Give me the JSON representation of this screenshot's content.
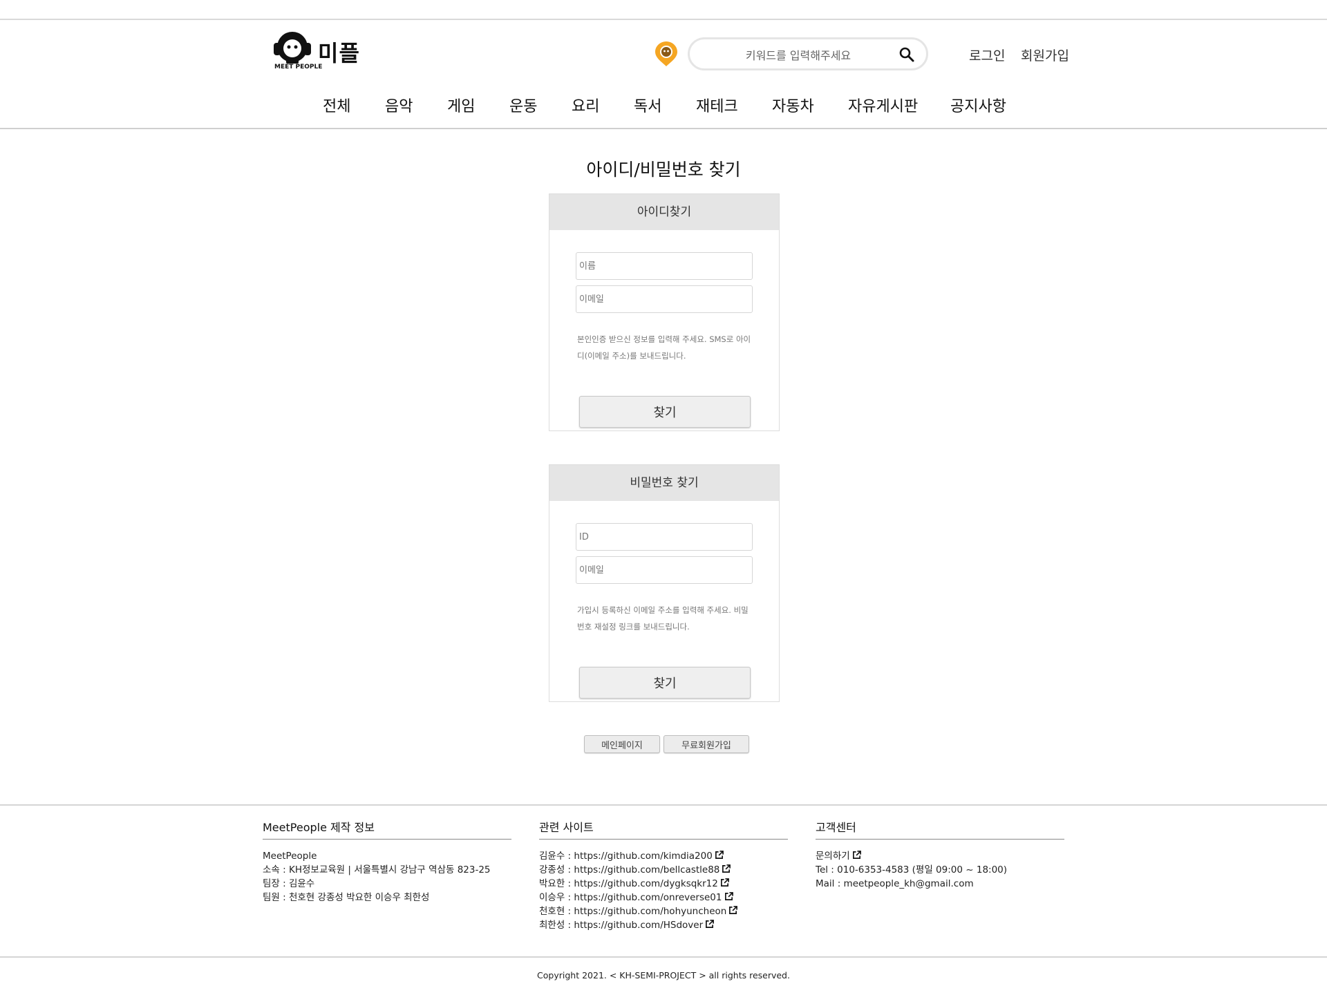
{
  "header": {
    "logo_text": "미플",
    "logo_sub": "MEET PEOPLE",
    "search_placeholder": "키워드를 입력해주세요",
    "login": "로그인",
    "signup": "회원가입"
  },
  "nav": [
    "전체",
    "음악",
    "게임",
    "운동",
    "요리",
    "독서",
    "재테크",
    "자동차",
    "자유게시판",
    "공지사항"
  ],
  "page_title": "아이디/비밀번호 찾기",
  "find_id": {
    "title": "아이디찾기",
    "name_placeholder": "이름",
    "email_placeholder": "이메일",
    "help_line1": "본인인증 받으신 정보를 입력해 주세요. SMS로 아이",
    "help_line2": "디(이메일 주소)를 보내드립니다.",
    "button": "찾기"
  },
  "find_pw": {
    "title": "비밀번호 찾기",
    "id_placeholder": "ID",
    "email_placeholder": "이메일",
    "help_line1": "가입시 등록하신 이메일 주소를 입력해 주세요. 비밀",
    "help_line2": "번호 재설정 링크를 보내드립니다.",
    "button": "찾기"
  },
  "bottom_buttons": {
    "main": "메인페이지",
    "signup": "무료회원가입"
  },
  "footer": {
    "info": {
      "title": "MeetPeople 제작 정보",
      "lines": [
        "MeetPeople",
        "소속 : KH정보교육원 | 서울특별시 강남구 역삼동 823-25",
        "팀장 : 김윤수",
        "팀원 : 천호현 강종성 박요한 이승우 최한성"
      ]
    },
    "sites": {
      "title": "관련 사이트",
      "links": [
        "김윤수 : https://github.com/kimdia200",
        "강종성 : https://github.com/bellcastle88",
        "박요한 : https://github.com/dygksqkr12",
        "이승우 : https://github.com/onreverse01",
        "천호현 : https://github.com/hohyuncheon",
        "최한성 : https://github.com/HSdover"
      ]
    },
    "support": {
      "title": "고객센터",
      "contact": "문의하기",
      "tel": "Tel : 010-6353-4583 (평일 09:00 ~ 18:00)",
      "mail": "Mail : meetpeople_kh@gmail.com"
    },
    "copyright": "Copyright 2021. < KH-SEMI-PROJECT > all rights reserved."
  },
  "colors": {
    "accent": "#f5a623",
    "panel_header": "#e5e5e5"
  }
}
